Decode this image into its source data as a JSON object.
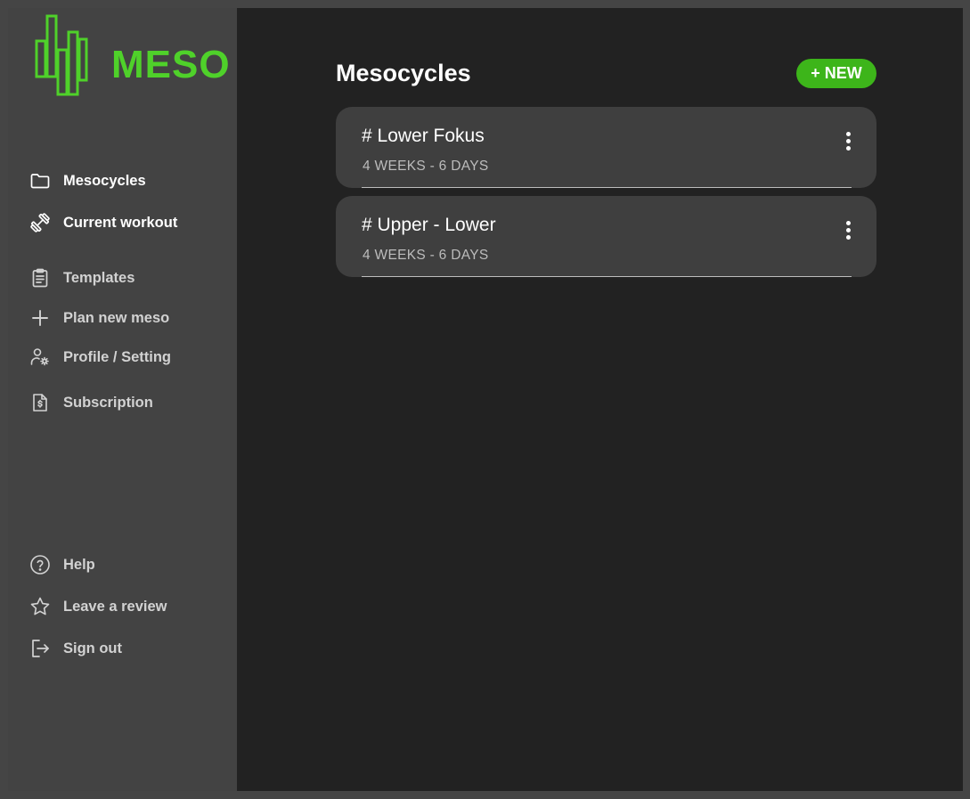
{
  "brand": {
    "name": "MESO",
    "accent": "#4fd12a"
  },
  "sidebar": {
    "primary": [
      {
        "label": "Mesocycles",
        "icon": "folder-icon"
      },
      {
        "label": "Current workout",
        "icon": "dumbbell-icon"
      }
    ],
    "secondary": [
      {
        "label": "Templates",
        "icon": "clipboard-icon"
      },
      {
        "label": "Plan new meso",
        "icon": "plus-icon"
      },
      {
        "label": "Profile / Setting",
        "icon": "user-settings-icon"
      },
      {
        "label": "Subscription",
        "icon": "dollar-document-icon"
      }
    ],
    "footer": [
      {
        "label": "Help",
        "icon": "help-icon"
      },
      {
        "label": "Leave a review",
        "icon": "star-icon"
      },
      {
        "label": "Sign out",
        "icon": "sign-out-icon"
      }
    ]
  },
  "main": {
    "title": "Mesocycles",
    "new_button": "+ NEW",
    "mesocycles": [
      {
        "title": "# Lower Fokus",
        "subtitle": "4 WEEKS - 6 DAYS"
      },
      {
        "title": "# Upper - Lower",
        "subtitle": "4 WEEKS - 6 DAYS"
      }
    ]
  }
}
